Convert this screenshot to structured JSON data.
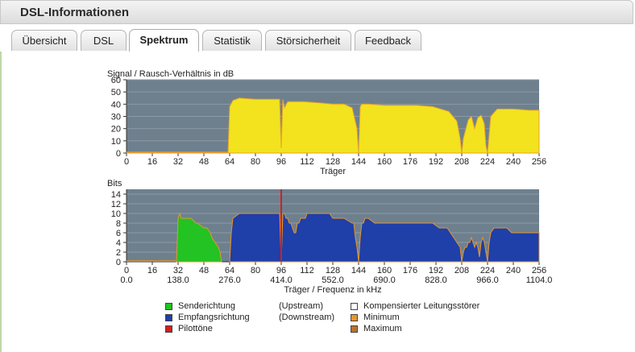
{
  "window": {
    "title": "DSL-Informationen"
  },
  "tabs": [
    {
      "label": "Übersicht",
      "active": false
    },
    {
      "label": "DSL",
      "active": false
    },
    {
      "label": "Spektrum",
      "active": true
    },
    {
      "label": "Statistik",
      "active": false
    },
    {
      "label": "Störsicherheit",
      "active": false
    },
    {
      "label": "Feedback",
      "active": false
    }
  ],
  "colors": {
    "plot_bg": "#6e808e",
    "snr_fill": "#f2e31e",
    "upstream": "#22c322",
    "downstream": "#1f3fa9",
    "pilot": "#d02020",
    "minimum": "#e8952b",
    "maximum": "#b8722e",
    "compensated": "#ffffff"
  },
  "chart_data": [
    {
      "type": "area",
      "ylabel": "Signal / Rausch-Verhältnis in dB",
      "xlabel": "Träger",
      "xlim": [
        0,
        256
      ],
      "ylim": [
        0,
        60
      ],
      "xticks": [
        0,
        16,
        32,
        48,
        64,
        80,
        96,
        112,
        128,
        144,
        160,
        176,
        192,
        208,
        224,
        240,
        256
      ],
      "yticks": [
        0,
        10,
        20,
        30,
        40,
        50,
        60
      ],
      "grid": true,
      "x": [
        0,
        63,
        64,
        66,
        70,
        80,
        90,
        95,
        96,
        97,
        98,
        100,
        110,
        120,
        128,
        135,
        140,
        143,
        144,
        145,
        146,
        150,
        160,
        170,
        180,
        190,
        200,
        205,
        207,
        208,
        209,
        212,
        214,
        216,
        218,
        220,
        222,
        223,
        224,
        226,
        230,
        240,
        250,
        256
      ],
      "values": [
        0,
        0,
        38,
        43,
        45,
        44,
        44,
        44,
        4,
        44,
        37,
        42,
        42,
        41,
        40,
        40,
        37,
        20,
        0,
        38,
        40,
        40,
        39,
        39,
        39,
        38,
        34,
        26,
        12,
        0,
        12,
        27,
        30,
        20,
        29,
        31,
        24,
        6,
        0,
        30,
        36,
        36,
        35,
        35
      ]
    },
    {
      "type": "area",
      "ylabel": "Bits",
      "xlabel": "Träger / Frequenz in kHz",
      "xlim": [
        0,
        256
      ],
      "ylim": [
        0,
        15
      ],
      "xticks": [
        0,
        16,
        32,
        48,
        64,
        80,
        96,
        112,
        128,
        144,
        160,
        176,
        192,
        208,
        224,
        240,
        256
      ],
      "freq_labels": [
        "0.0",
        "138.0",
        "276.0",
        "414.0",
        "552.0",
        "690.0",
        "828.0",
        "966.0",
        "1104.0"
      ],
      "yticks": [
        0,
        2,
        4,
        6,
        8,
        10,
        12,
        14
      ],
      "grid": true,
      "pilot_tone": 96,
      "series": [
        {
          "name": "Senderichtung",
          "x": [
            31,
            32,
            33,
            34,
            40,
            43,
            44,
            48,
            50,
            52,
            53,
            55,
            57,
            58,
            59
          ],
          "values": [
            0,
            9,
            10,
            9,
            9,
            8,
            8,
            7,
            7,
            6,
            5,
            4,
            3,
            2,
            0
          ]
        },
        {
          "name": "Empfangsrichtung",
          "x": [
            64,
            65,
            66,
            70,
            80,
            94,
            95,
            96,
            97,
            98,
            99,
            100,
            101,
            102,
            103,
            104,
            105,
            106,
            107,
            108,
            110,
            111,
            112,
            120,
            126,
            128,
            135,
            140,
            141,
            142,
            143,
            144,
            145,
            146,
            147,
            148,
            150,
            154,
            170,
            190,
            194,
            199,
            201,
            203,
            205,
            207,
            208,
            209,
            210,
            211,
            212,
            213,
            214,
            215,
            216,
            217,
            218,
            219,
            220,
            221,
            222,
            223,
            224,
            225,
            226,
            228,
            232,
            236,
            239,
            240,
            250,
            256
          ],
          "values": [
            0,
            6,
            9,
            10,
            10,
            10,
            10,
            0,
            10,
            10,
            9,
            9,
            8,
            8,
            7,
            6,
            6,
            8,
            8,
            9,
            9,
            9,
            10,
            10,
            10,
            9,
            9,
            8,
            8,
            5,
            3,
            0,
            5,
            8,
            8,
            9,
            9,
            8,
            8,
            8,
            7,
            7,
            6,
            5,
            4,
            3,
            0,
            2,
            3,
            3,
            4,
            4,
            5,
            4,
            3,
            4,
            3,
            1,
            4,
            5,
            4,
            2,
            0,
            4,
            6,
            7,
            7,
            7,
            6,
            6,
            6,
            6
          ]
        }
      ]
    }
  ],
  "legend": {
    "upstream_label": "Senderichtung",
    "upstream_note": "(Upstream)",
    "downstream_label": "Empfangsrichtung",
    "downstream_note": "(Downstream)",
    "pilot_label": "Pilottöne",
    "compensated_label": "Kompensierter Leitungsstörer",
    "minimum_label": "Minimum",
    "maximum_label": "Maximum"
  }
}
